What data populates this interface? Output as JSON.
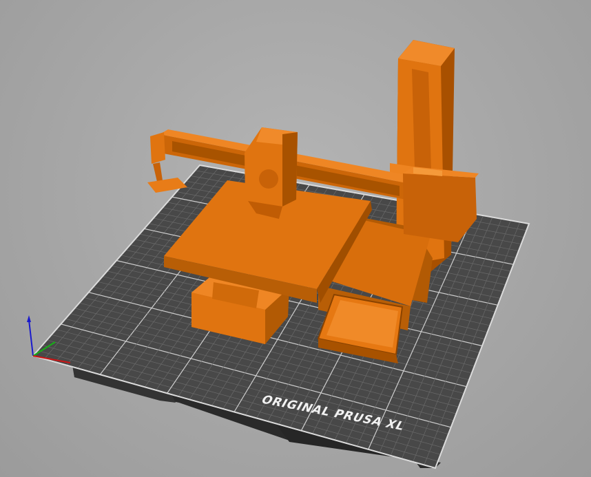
{
  "viewport": {
    "background_color": "#a6a6a6",
    "model_color": "#e07010"
  },
  "bed": {
    "label": "ORIGINAL PRUSA XL",
    "grid_color": "#4a4a4a",
    "line_color": "#e8e8e8",
    "base_color": "#2b2b2b"
  },
  "axes": {
    "x_color": "#d01010",
    "y_color": "#10b010",
    "z_color": "#1010d0"
  }
}
